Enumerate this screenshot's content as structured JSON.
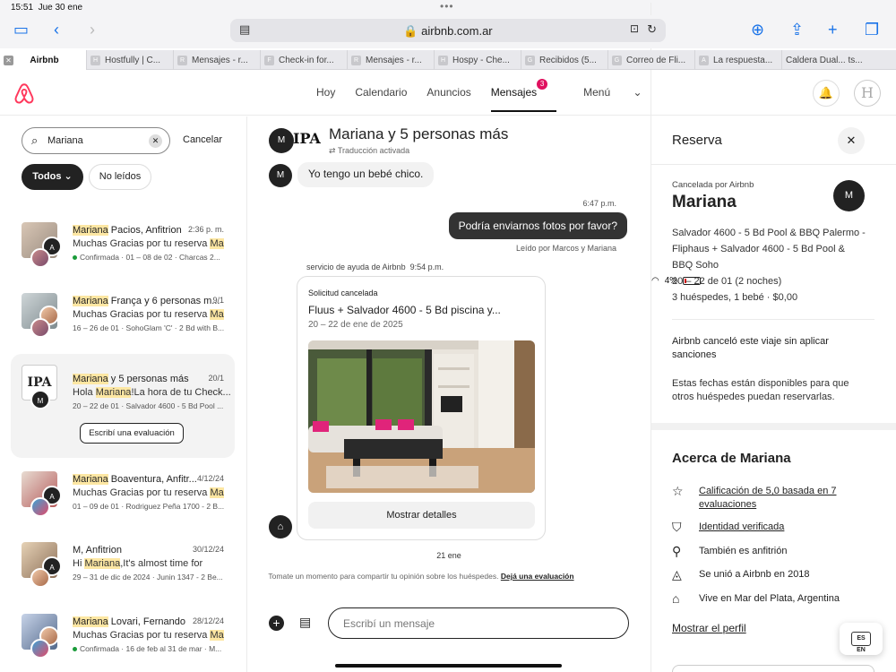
{
  "status_bar": {
    "time": "15:51",
    "date": "Jue 30 ene",
    "battery": "4%"
  },
  "browser": {
    "url": "airbnb.com.ar",
    "tabs": [
      {
        "fav": "A",
        "label": "Airbnb",
        "active": true
      },
      {
        "fav": "H",
        "label": "Hostfully | C..."
      },
      {
        "fav": "R",
        "label": "Mensajes - r..."
      },
      {
        "fav": "F",
        "label": "Check-in for..."
      },
      {
        "fav": "R",
        "label": "Mensajes - r..."
      },
      {
        "fav": "H",
        "label": "Hospy - Che..."
      },
      {
        "fav": "G",
        "label": "Recibidos (5..."
      },
      {
        "fav": "G",
        "label": "Correo de Fli..."
      },
      {
        "fav": "A",
        "label": "La respuesta..."
      },
      {
        "fav": "",
        "label": "Caldera Dual... ts..."
      }
    ]
  },
  "nav": {
    "items": [
      "Hoy",
      "Calendario",
      "Anuncios",
      "Mensajes",
      "Menú"
    ],
    "badge": "3"
  },
  "left": {
    "search_value": "Mariana",
    "cancel": "Cancelar",
    "filters": [
      "Todos",
      "No leídos"
    ],
    "conversations": [
      {
        "hl": "Mariana",
        "name": " Pacios, Anfitrion",
        "date": "2:36 p. m.",
        "msg": "Muchas Gracias por tu reserva ",
        "msg_hl": "Ma",
        "meta": "Confirmada · 01 – 08 de 02 · Charcas 2..."
      },
      {
        "hl": "Mariana",
        "name": " França y 6 personas m...",
        "date": "9/1",
        "msg": "Muchas Gracias por tu reserva ",
        "msg_hl": "Ma",
        "meta": "16 – 26 de 01 · SohoGlam 'C' · 2 Bd with B..."
      },
      {
        "hl": "Mariana",
        "name": " y 5 personas más",
        "date": "20/1",
        "msg_pre": "Hola ",
        "msg_hl": "Mariana",
        "msg": "!La hora de tu Check...",
        "meta": "20 – 22 de 01 · Salvador 4600 - 5 Bd Pool ...",
        "button": "Escribí una evaluación"
      },
      {
        "hl": "Mariana",
        "name": " Boaventura, Anfitr...",
        "date": "4/12/24",
        "msg": "Muchas Gracias por tu reserva ",
        "msg_hl": "Ma",
        "meta": "01 – 09 de 01 · Rodriguez Peña 1700 - 2 B..."
      },
      {
        "name": "M, Anfitrion",
        "date": "30/12/24",
        "msg_pre": "Hi ",
        "msg_hl": "Mariana",
        "msg": ",It's almost time for",
        "meta": "29 – 31 de dic de 2024 · Junin 1347 - 2 Be..."
      },
      {
        "hl": "Mariana",
        "name": " Lovari, Fernando",
        "date": "28/12/24",
        "msg": "Muchas Gracias por tu reserva ",
        "msg_hl": "Ma",
        "meta": "Confirmada · 16 de feb al 31 de mar · M..."
      }
    ]
  },
  "chat": {
    "title": "Mariana y 5 personas más",
    "subtitle": "Traducción activada",
    "avatar": "M",
    "logo_text": "IPA",
    "msg_in": "Yo tengo un bebé chico.",
    "time_out": "6:47 p.m.",
    "msg_out": "Podría enviarnos fotos por favor?",
    "read": "Leído por Marcos y Mariana",
    "service_label": "servicio de ayuda de Airbnb",
    "service_time": "9:54 p.m.",
    "card_tag": "Solicitud cancelada",
    "card_title": "Fluus + Salvador 4600 - 5 Bd piscina y...",
    "card_dates": "20 – 22 de ene de 2025",
    "card_button": "Mostrar detalles",
    "day": "21 ene",
    "prompt": "Tomate un momento para compartir tu opinión sobre los huéspedes.",
    "prompt_link": "Dejá una evaluación",
    "composer_placeholder": "Escribí un mensaje"
  },
  "reserva": {
    "title": "Reserva",
    "cancel_note": "Cancelada por Airbnb",
    "guest": "Mariana",
    "avatar": "M",
    "listing": [
      "Salvador 4600 - 5 Bd Pool & BBQ Palermo -",
      "Fliphaus + Salvador 4600 - 5 Bd Pool &",
      "BBQ Soho",
      "20 – 22 de 01 (2 noches)",
      "3 huéspedes, 1 bebé · $0,00"
    ],
    "notice": "Airbnb canceló este viaje sin aplicar sanciones",
    "availability": "Estas fechas están disponibles para que otros huéspedes puedan reservarlas.",
    "about_title": "Acerca de Mariana",
    "about": [
      {
        "icon": "☆",
        "text": "Calificación de 5,0 basada en 7 evaluaciones",
        "link": true
      },
      {
        "icon": "⛉",
        "text": "Identidad verificada",
        "link": true
      },
      {
        "icon": "⚲",
        "text": "También es anfitrión",
        "link": false
      },
      {
        "icon": "◬",
        "text": "Se unió a Airbnb en 2018",
        "link": false
      },
      {
        "icon": "⌂",
        "text": "Vive en Mar del Plata, Argentina",
        "link": false
      }
    ],
    "profile_link": "Mostrar el perfil"
  },
  "colors": {
    "brand": "#FF385C",
    "badge": "#E0115F",
    "highlight": "#FDE7A3"
  }
}
